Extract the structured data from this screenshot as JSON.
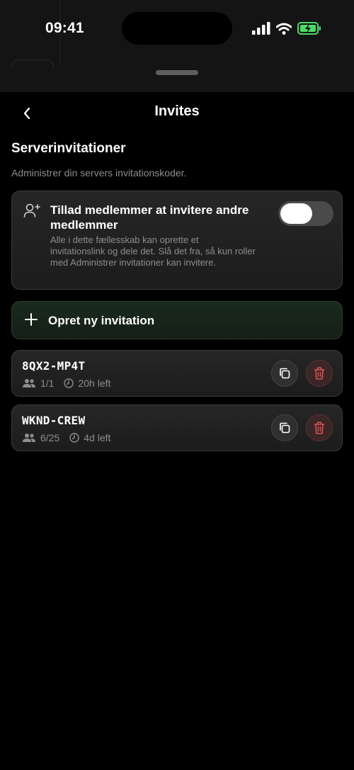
{
  "status_bar": {
    "time": "09:41"
  },
  "nav": {
    "title": "Invites"
  },
  "section": {
    "title": "Serverinvitationer",
    "description": "Administrer din servers invitationskoder."
  },
  "allow_invites": {
    "title": "Tillad medlemmer at invitere andre medlemmer",
    "description": "Alle i dette fællesskab kan oprette et invitationslink og dele det. Slå det fra, så kun roller med Administrer invitationer kan invitere.",
    "enabled": false
  },
  "create_button": {
    "label": "Opret ny invitation"
  },
  "invites": [
    {
      "code": "8QX2-MP4T",
      "uses": "1/1",
      "expires": "20h left"
    },
    {
      "code": "WKND-CREW",
      "uses": "6/25",
      "expires": "4d left"
    }
  ],
  "icons": {
    "back": "chevron-left-icon",
    "person_add": "person-add-icon",
    "plus": "plus-icon",
    "members": "people-icon",
    "clock": "clock-icon",
    "copy": "copy-icon",
    "delete": "trash-icon"
  },
  "colors": {
    "background": "#000000",
    "card": "#222222",
    "accent_green": "#1a2a1e",
    "danger": "#e05252",
    "battery": "#4cd964"
  }
}
